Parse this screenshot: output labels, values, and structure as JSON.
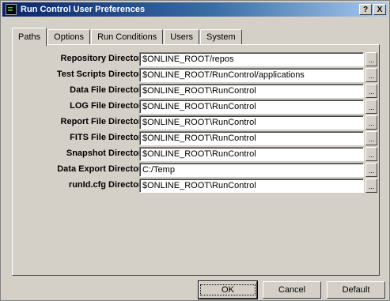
{
  "window": {
    "title": "Run Control User Preferences",
    "help_label": "?",
    "close_label": "X"
  },
  "tabs": [
    {
      "label": "Paths",
      "active": true
    },
    {
      "label": "Options",
      "active": false
    },
    {
      "label": "Run Conditions",
      "active": false
    },
    {
      "label": "Users",
      "active": false
    },
    {
      "label": "System",
      "active": false
    }
  ],
  "fields": [
    {
      "label": "Repository Directory:",
      "value": "$ONLINE_ROOT/repos"
    },
    {
      "label": "Test Scripts Directory:",
      "value": "$ONLINE_ROOT/RunControl/applications"
    },
    {
      "label": "Data File Directory:",
      "value": "$ONLINE_ROOT\\RunControl"
    },
    {
      "label": "LOG File Directory:",
      "value": "$ONLINE_ROOT\\RunControl"
    },
    {
      "label": "Report File Directory:",
      "value": "$ONLINE_ROOT\\RunControl"
    },
    {
      "label": "FITS File Directory:",
      "value": "$ONLINE_ROOT\\RunControl"
    },
    {
      "label": "Snapshot Directory:",
      "value": "$ONLINE_ROOT\\RunControl"
    },
    {
      "label": "Data Export Directory:",
      "value": "C:/Temp"
    },
    {
      "label": "runId.cfg Directory:",
      "value": "$ONLINE_ROOT\\RunControl"
    }
  ],
  "browse_label": "...",
  "buttons": {
    "ok": "OK",
    "cancel": "Cancel",
    "default": "Default"
  }
}
